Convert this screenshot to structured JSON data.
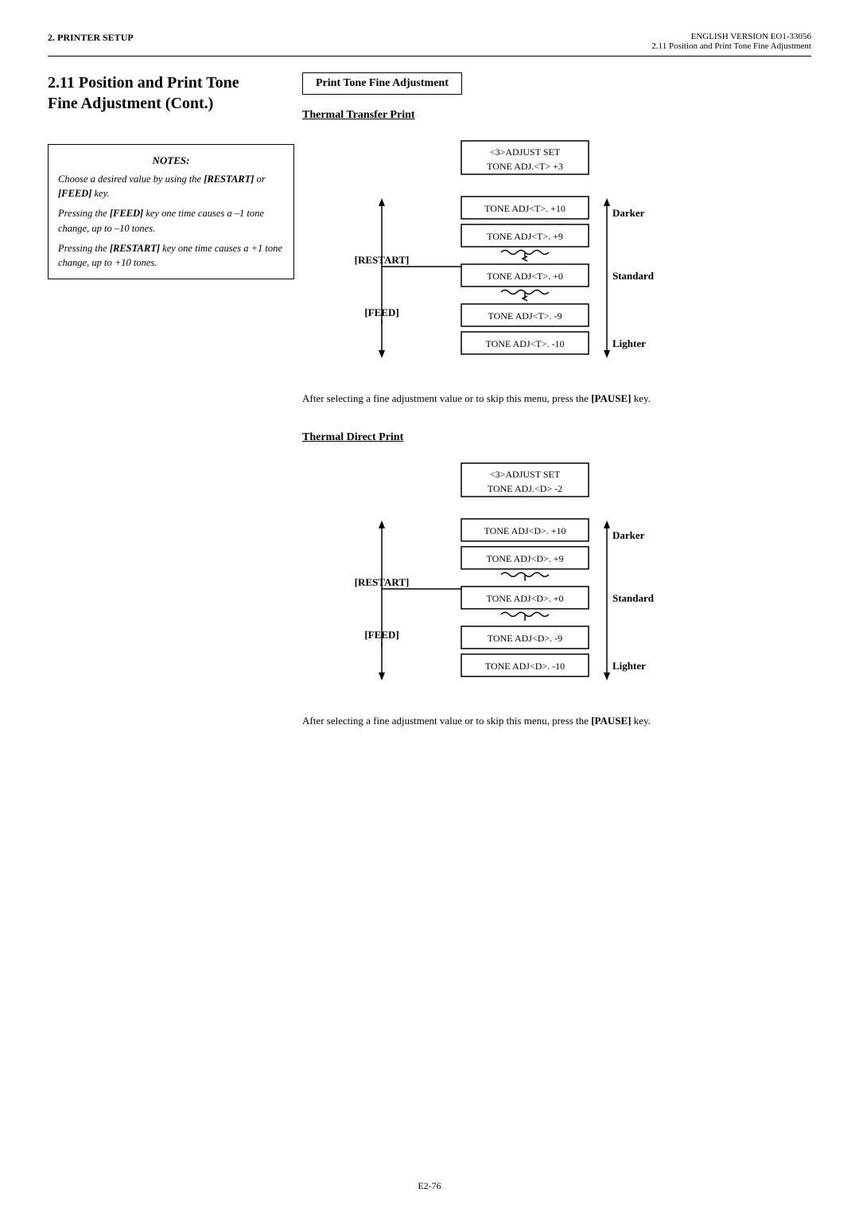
{
  "header": {
    "left": "2. PRINTER SETUP",
    "right_line1": "ENGLISH VERSION EO1-33056",
    "right_line2": "2.11 Position and Print Tone Fine Adjustment"
  },
  "section": {
    "number": "2.11",
    "title": "Position and Print Tone Fine Adjustment (Cont.)"
  },
  "ptfa_box": "Print Tone Fine Adjustment",
  "thermal_transfer": {
    "heading": "Thermal Transfer Print",
    "adjust_set": "<3>ADJUST SET\nTONE ADJ.<T> +3",
    "entries": [
      "TONE ADJ<T>. +10",
      "TONE ADJ<T>. +9",
      "TONE ADJ<T>. +0",
      "TONE ADJ<T>. -9",
      "TONE ADJ<T>. -10"
    ],
    "labels": {
      "darker": "Darker",
      "standard": "Standard",
      "lighter": "Lighter",
      "restart": "[RESTART]",
      "feed": "[FEED]"
    }
  },
  "thermal_direct": {
    "heading": "Thermal Direct Print",
    "adjust_set": "<3>ADJUST SET\nTONE ADJ.<D> -2",
    "entries": [
      "TONE ADJ<D>. +10",
      "TONE ADJ<D>. +9",
      "TONE ADJ<D>. +0",
      "TONE ADJ<D>. -9",
      "TONE ADJ<D>. -10"
    ],
    "labels": {
      "darker": "Darker",
      "standard": "Standard",
      "lighter": "Lighter",
      "restart": "[RESTART]",
      "feed": "[FEED]"
    }
  },
  "notes": {
    "title": "NOTES:",
    "lines": [
      "Choose a desired value by using the [RESTART] or [FEED] key.",
      "Pressing the [FEED] key one time causes a –1 tone change, up to –10 tones.",
      "Pressing the [RESTART] key one time causes a +1 tone change, up to +10 tones."
    ]
  },
  "after_text_1": "After selecting a fine adjustment value or to skip this menu, press the [PAUSE] key.",
  "after_text_2": "After selecting a fine adjustment value or to skip this menu, press the [PAUSE] key.",
  "footer": "E2-76"
}
